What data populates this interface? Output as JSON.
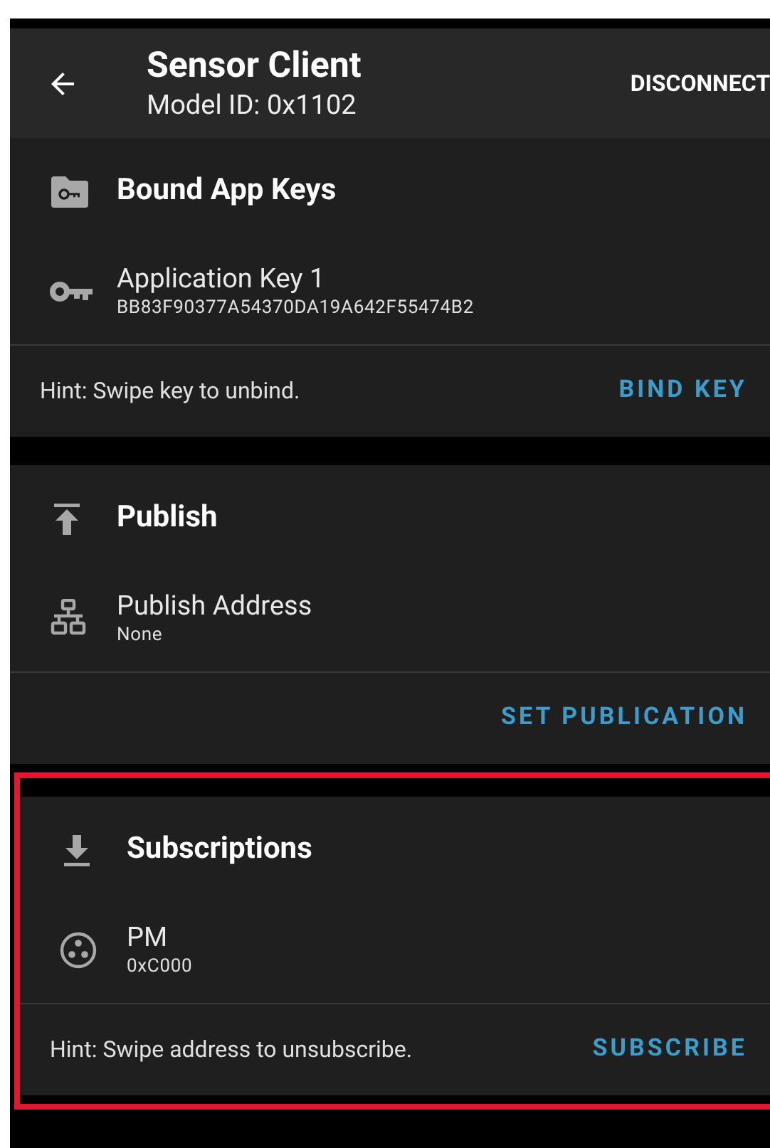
{
  "app_bar": {
    "title": "Sensor Client",
    "subtitle": "Model ID: 0x1102",
    "action": "DISCONNECT"
  },
  "sections": [
    {
      "kind": "app_keys",
      "title": "Bound App Keys",
      "highlighted": false,
      "items": [
        {
          "title": "Application Key 1",
          "subtitle": "BB83F90377A54370DA19A642F55474B2"
        }
      ],
      "hint": "Hint: Swipe key to unbind.",
      "action": "BIND KEY"
    },
    {
      "kind": "publish",
      "title": "Publish",
      "highlighted": false,
      "items": [
        {
          "title": "Publish Address",
          "subtitle": "None"
        }
      ],
      "action": "SET PUBLICATION"
    },
    {
      "kind": "subscriptions",
      "title": "Subscriptions",
      "highlighted": true,
      "items": [
        {
          "title": "PM",
          "subtitle": "0xC000"
        }
      ],
      "hint": "Hint: Swipe address to unsubscribe.",
      "action": "SUBSCRIBE"
    }
  ]
}
